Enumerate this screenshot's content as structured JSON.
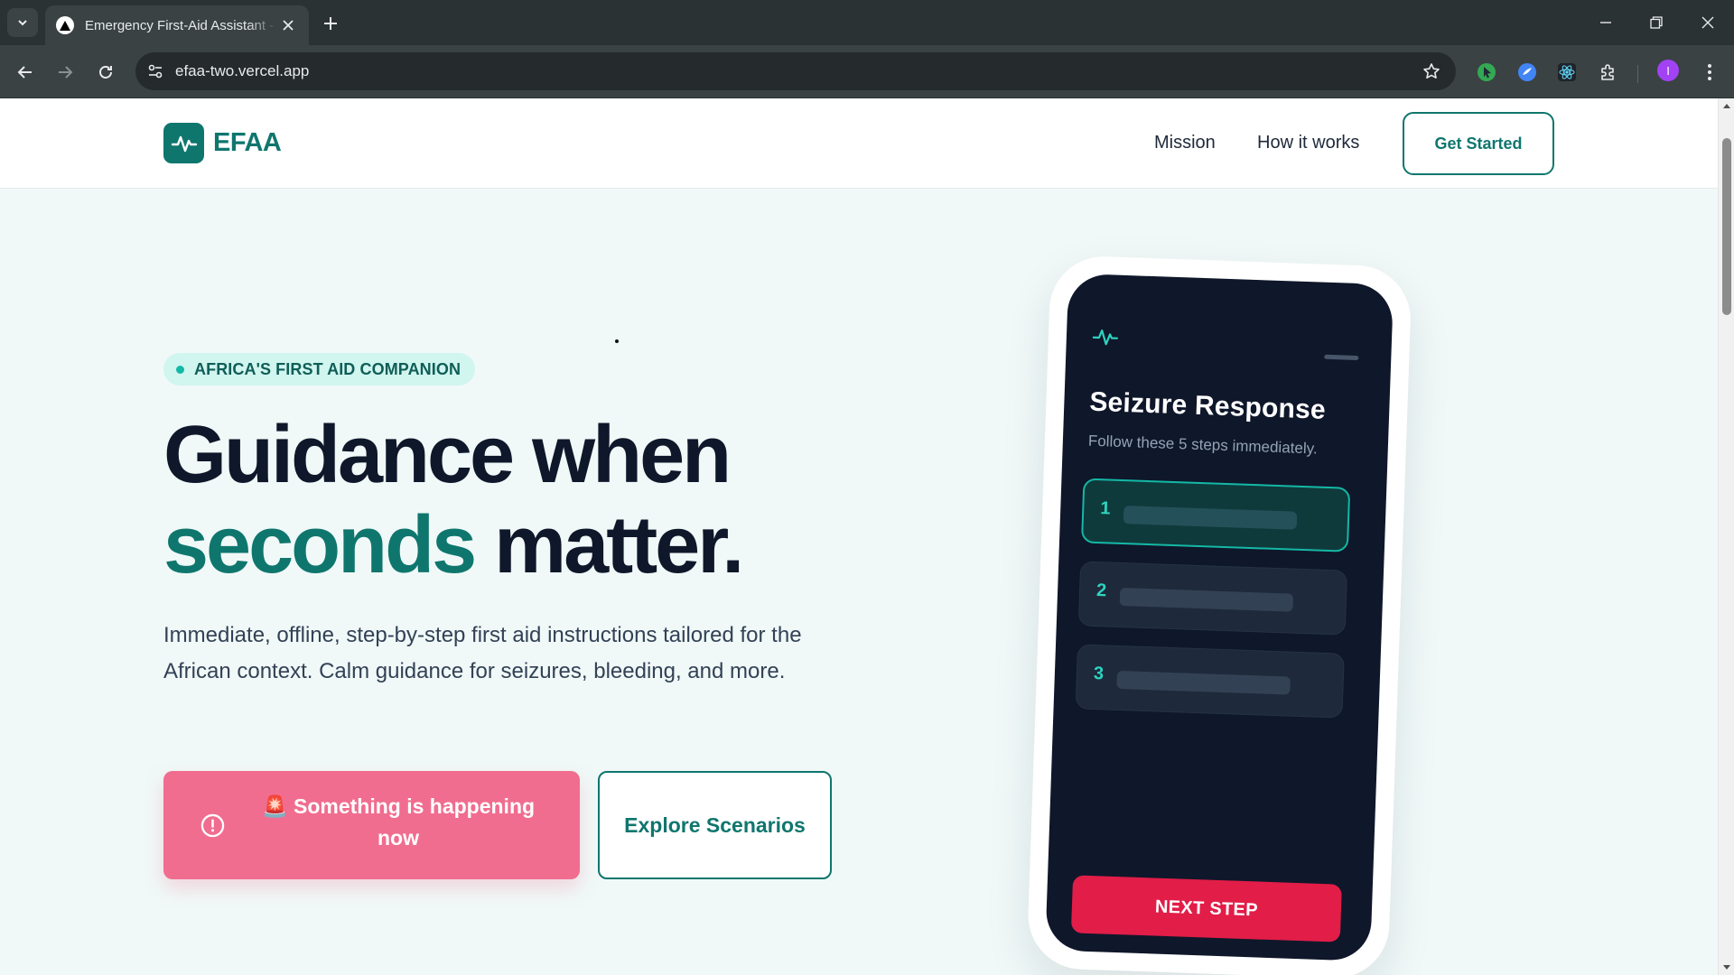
{
  "browser": {
    "tab_title": "Emergency First-Aid Assistant - EFAA",
    "url": "efaa-two.vercel.app",
    "profile_initial": "I"
  },
  "header": {
    "logo_text": "EFAA",
    "nav": [
      {
        "label": "Mission"
      },
      {
        "label": "How it works"
      }
    ],
    "cta_label": "Get Started"
  },
  "hero": {
    "badge": "AFRICA'S FIRST AID COMPANION",
    "title_line1": "Guidance when",
    "title_accent": "seconds",
    "title_line2_rest": " matter.",
    "description": "Immediate, offline, step-by-step first aid instructions tailored for the African context. Calm guidance for seizures, bleeding, and more.",
    "primary_button": "🚨 Something is happening now",
    "secondary_button": "Explore Scenarios"
  },
  "phone": {
    "title": "Seizure Response",
    "subtitle": "Follow these 5 steps immediately.",
    "steps": [
      {
        "number": "1",
        "active": true
      },
      {
        "number": "2",
        "active": false
      },
      {
        "number": "3",
        "active": false
      }
    ],
    "next_button": "NEXT STEP"
  },
  "colors": {
    "brand": "#0f766e",
    "accent_teal": "#14b8a6",
    "emergency_pink": "#f06d8f",
    "next_red": "#e11d48",
    "dark_screen": "#0f172a"
  },
  "scroll": {
    "position_fraction": 0.05
  }
}
